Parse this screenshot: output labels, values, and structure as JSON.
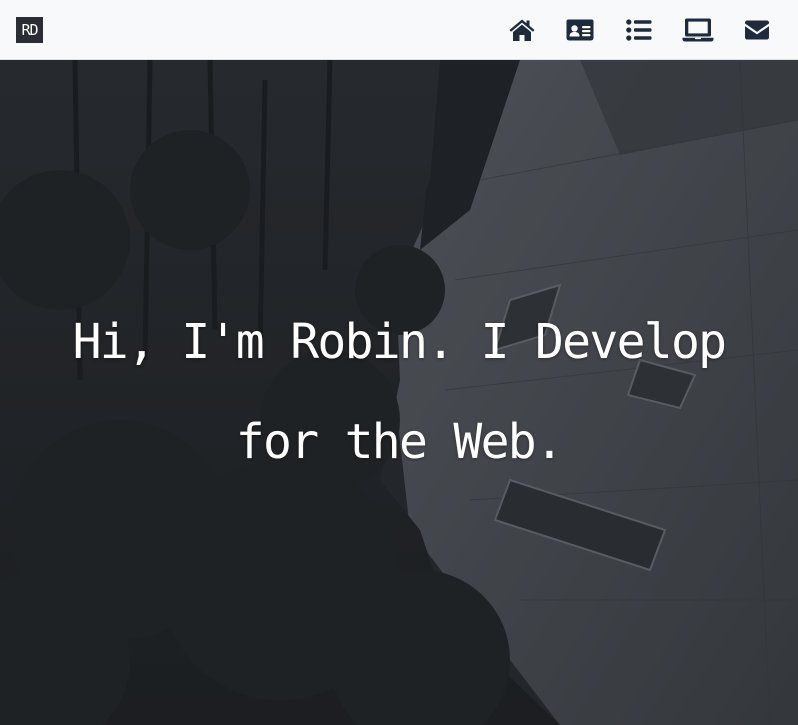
{
  "header": {
    "logo_text": "RD",
    "nav": [
      {
        "id": "home",
        "icon": "home-icon"
      },
      {
        "id": "about",
        "icon": "id-card-icon"
      },
      {
        "id": "resume",
        "icon": "list-icon"
      },
      {
        "id": "portfolio",
        "icon": "laptop-icon"
      },
      {
        "id": "contact",
        "icon": "envelope-icon"
      }
    ]
  },
  "hero": {
    "headline": "Hi, I'm Robin. I Develop for the Web."
  },
  "colors": {
    "navbar_bg": "#f8f9fa",
    "icon": "#1f2a3c",
    "hero_overlay": "#25282c",
    "headline": "#ffffff"
  }
}
